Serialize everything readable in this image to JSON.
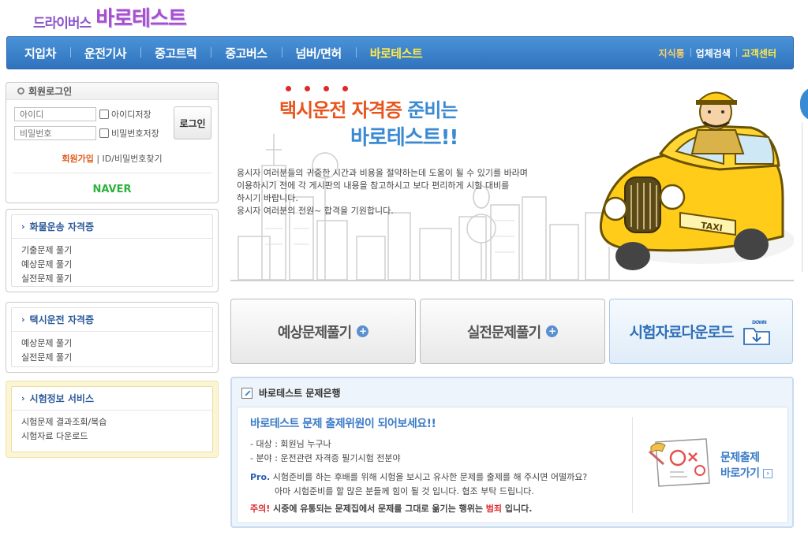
{
  "logo": {
    "small": "드라이버스",
    "big": "바로테스트"
  },
  "gnb": {
    "items": [
      "지입차",
      "운전기사",
      "중고트럭",
      "중고버스",
      "넘버/면허",
      "바로테스트"
    ],
    "utils": [
      "지식통",
      "업체검색",
      "고객센터"
    ]
  },
  "login": {
    "title": "회원로그인",
    "id_placeholder": "아이디",
    "pw_placeholder": "비밀번호",
    "save_id": "아이디저장",
    "save_pw": "비밀번호저장",
    "button": "로그인",
    "join": "회원가입",
    "divider": "|",
    "find": "ID/비밀번호찾기",
    "naver": "NAVER"
  },
  "categories": [
    {
      "title": "화물운송 자격증",
      "links": [
        "기출문제 풀기",
        "예상문제 풀기",
        "실전문제 풀기"
      ]
    },
    {
      "title": "택시운전 자격증",
      "links": [
        "예상문제 풀기",
        "실전문제 풀기"
      ]
    },
    {
      "title": "시험정보 서비스",
      "links": [
        "시험문제 결과조회/복습",
        "시험자료 다운로드"
      ]
    }
  ],
  "hero": {
    "title_red": "택시운전 자격증",
    "title_blue": "준비는",
    "title2": "바로테스트!!",
    "desc": [
      "응시자 여러분들의 귀중한 시간과 비용을 절약하는데 도움이 될 수 있기를 바라며",
      "이용하시기 전에 각 게시판의 내용을 참고하시고 보다 편리하게 시험 대비를",
      "하시기 바랍니다.",
      "응시자 여러분의 전원~ 합격을 기원합니다."
    ],
    "taxi_sign": "TAXI"
  },
  "quick": [
    "예상문제풀기",
    "실전문제풀기",
    "시험자료다운로드"
  ],
  "download_tag": "DOWN",
  "bank": {
    "title": "바로테스트 문제은행",
    "headline": "바로테스트 문제 출제위원이 되어보세요!!",
    "target": "- 대상 : 회원님 누구나",
    "field": "- 분야 : 운전관련 자격증 필기시험 전분야",
    "pro_label": "Pro.",
    "pro_line1": " 시험준비를 하는 후배를 위해 시험을 보시고 유사한 문제를 출제를 해 주시면 어떨까요?",
    "pro_line2": "아마 시험준비를 할 많은 분들께 힘이 될 것 입니다. 협조 부탁 드립니다.",
    "warn_label": "주의!",
    "warn_text1": " 시중에 유통되는 문제집에서 문제를 그대로 옮기는 행위는 ",
    "warn_red": "범죄",
    "warn_text2": " 입니다.",
    "shortcut1": "문제출제",
    "shortcut2": "바로가기"
  },
  "colors": {
    "nav_blue": "#2f73bd",
    "accent_blue": "#3a8ad3",
    "orange": "#e8541b",
    "active_yellow": "#ffe94a"
  }
}
